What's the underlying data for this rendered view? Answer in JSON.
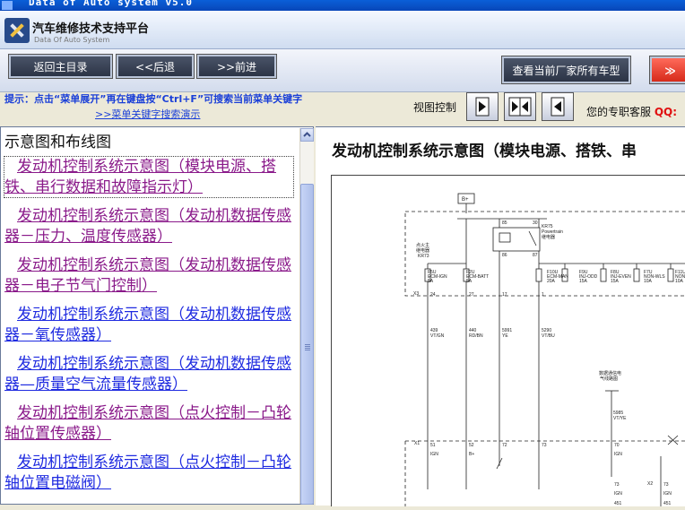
{
  "window": {
    "title": "Data of Auto system v5.0"
  },
  "app": {
    "title": "汽车维修技术支持平台",
    "subtitle": "Data Of Auto System"
  },
  "nav": {
    "home": "返回主目录",
    "back": "<<后退",
    "forward": ">>前进",
    "all_models": "查看当前厂家所有车型",
    "more": "≫"
  },
  "hint": {
    "text": "提示：点击“菜单展开”再在键盘按“Ctrl+F”可搜索当前菜单关键字",
    "link": ">>菜单关键字搜索演示"
  },
  "view": {
    "label": "视图控制"
  },
  "support": {
    "text": "您的专职客服",
    "qq": "QQ:"
  },
  "sidebar": {
    "heading": "示意图和布线图",
    "items": [
      {
        "label": "发动机控制系统示意图（模块电源、搭铁、串行数据和故障指示灯）",
        "visited": true,
        "active": true
      },
      {
        "label": "发动机控制系统示意图（发动机数据传感器－压力、温度传感器）",
        "visited": true
      },
      {
        "label": "发动机控制系统示意图（发动机数据传感器－电子节气门控制）",
        "visited": true
      },
      {
        "label": "发动机控制系统示意图（发动机数据传感器－氧传感器）",
        "visited": false
      },
      {
        "label": "发动机控制系统示意图（发动机数据传感器—质量空气流量传感器）",
        "visited": false
      },
      {
        "label": "发动机控制系统示意图（点火控制－凸轮轴位置传感器）",
        "visited": true
      },
      {
        "label": "发动机控制系统示意图（点火控制－凸轮轴位置电磁阀）",
        "visited": false
      }
    ]
  },
  "content": {
    "title": "发动机控制系统示意图（模块电源、搭铁、串"
  },
  "diagram": {
    "battery": "B+",
    "relay_pins": [
      "85",
      "30",
      "86",
      "87"
    ],
    "relay_id": "KR75",
    "relay_name": "Powertrain",
    "relay_name2": "继电器",
    "ign_relay_text": "点火主",
    "ign_relay_text2": "继电器",
    "ign_relay_id": "KR73",
    "fuses": [
      {
        "id": "F5U",
        "name": "ECM-IGN",
        "amp": "5A"
      },
      {
        "id": "F2U",
        "name": "ECM-BATT",
        "amp": "5A"
      },
      {
        "id": "F10U",
        "name": "ECM-MAN",
        "amp": "20A"
      },
      {
        "id": "F9U",
        "name": "INJ-ODD",
        "amp": "15A"
      },
      {
        "id": "F8U",
        "name": "INJ-EVEN",
        "amp": "15A"
      },
      {
        "id": "F7U",
        "name": "NON-WLS",
        "amp": "10A"
      },
      {
        "id": "F11U",
        "name": "NON-WLS",
        "amp": "10A"
      }
    ],
    "conn_x3": "X3",
    "x3_pins": [
      "24",
      "27",
      "17",
      "1"
    ],
    "wires": [
      {
        "num": "439",
        "color": "VT/GN"
      },
      {
        "num": "440",
        "color": "RD/BN"
      },
      {
        "num": "5991",
        "color": "YE"
      },
      {
        "num": "5290",
        "color": "VT/BU"
      }
    ],
    "data_link_text": "数据通信电",
    "data_link_text2": "气线路图",
    "wire_5985": {
      "num": "5985",
      "color": "VT/YE"
    },
    "conn_x1": "X1",
    "x1_pins": [
      "51",
      "52",
      "72",
      "73",
      "70"
    ],
    "x1_labels": [
      "IGN",
      "B+",
      "",
      "",
      "IGN"
    ],
    "conn_x2": "X2",
    "x2_pins": [
      "73",
      "73"
    ],
    "bottom_labels": [
      "IGN",
      "IGN"
    ],
    "bottom_wires": [
      "451",
      "451"
    ]
  }
}
